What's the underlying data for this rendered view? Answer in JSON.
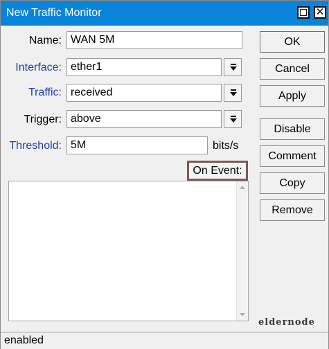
{
  "window": {
    "title": "New Traffic Monitor",
    "titlebar_color": "#0a84d8",
    "controls": {
      "restore_icon": "restore-window-icon",
      "close_icon": "close-icon",
      "close_glyph": "✕"
    }
  },
  "form": {
    "name": {
      "label": "Name:",
      "value": "WAN 5M"
    },
    "interface": {
      "label": "Interface:",
      "value": "ether1",
      "dropdown_icon": "dropdown-arrow-icon"
    },
    "traffic": {
      "label": "Traffic:",
      "value": "received",
      "dropdown_icon": "dropdown-arrow-icon"
    },
    "trigger": {
      "label": "Trigger:",
      "value": "above",
      "dropdown_icon": "dropdown-arrow-icon"
    },
    "threshold": {
      "label": "Threshold:",
      "value": "5M",
      "unit": "bits/s"
    },
    "on_event": {
      "label": "On Event:",
      "value": ""
    }
  },
  "buttons": {
    "ok": "OK",
    "cancel": "Cancel",
    "apply": "Apply",
    "disable": "Disable",
    "comment": "Comment",
    "copy": "Copy",
    "remove": "Remove"
  },
  "watermark": "eldernode",
  "status": {
    "text": "enabled"
  },
  "colors": {
    "link_label": "#1f3fa8",
    "highlight_border": "#7a5a58"
  }
}
